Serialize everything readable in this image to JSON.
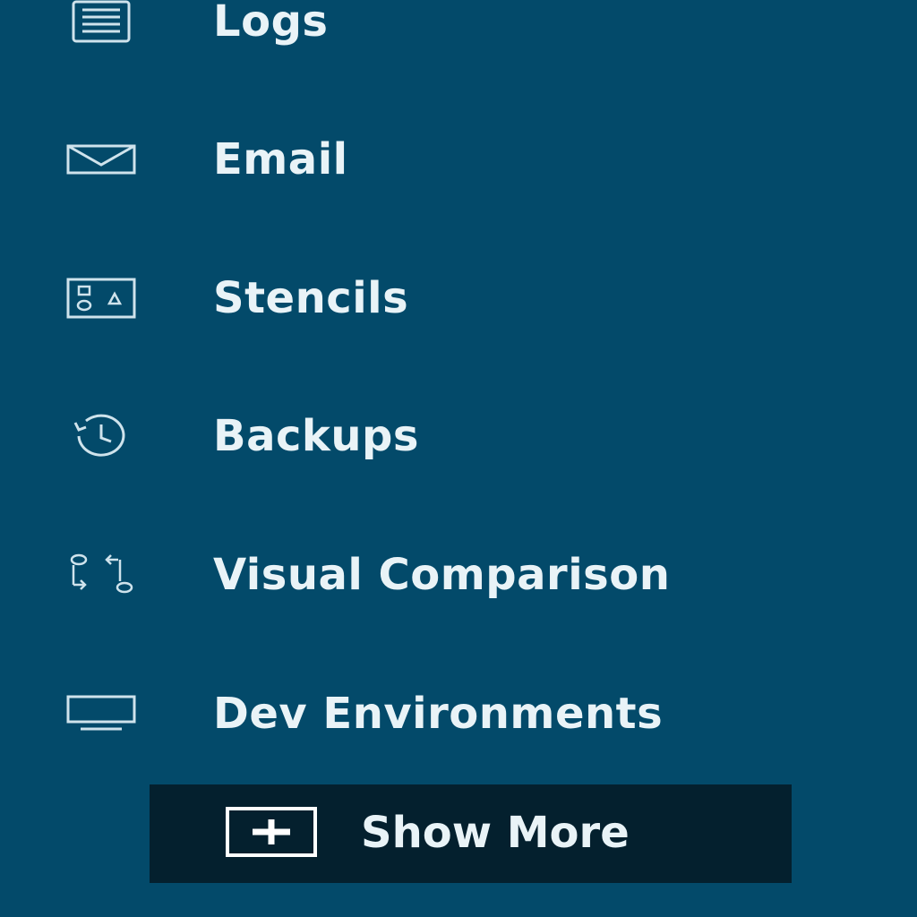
{
  "sidebar": {
    "items": [
      {
        "label": "Logs",
        "icon": "document-lines-icon"
      },
      {
        "label": "Email",
        "icon": "envelope-icon"
      },
      {
        "label": "Stencils",
        "icon": "shapes-icon"
      },
      {
        "label": "Backups",
        "icon": "history-clock-icon"
      },
      {
        "label": "Visual Comparison",
        "icon": "compare-arrows-icon"
      },
      {
        "label": "Dev Environments",
        "icon": "monitor-icon"
      }
    ],
    "show_more": {
      "label": "Show More",
      "icon": "plus-box-icon"
    }
  },
  "colors": {
    "background": "#034a6a",
    "show_more_background": "#04202e",
    "text": "#e9f3f7"
  }
}
